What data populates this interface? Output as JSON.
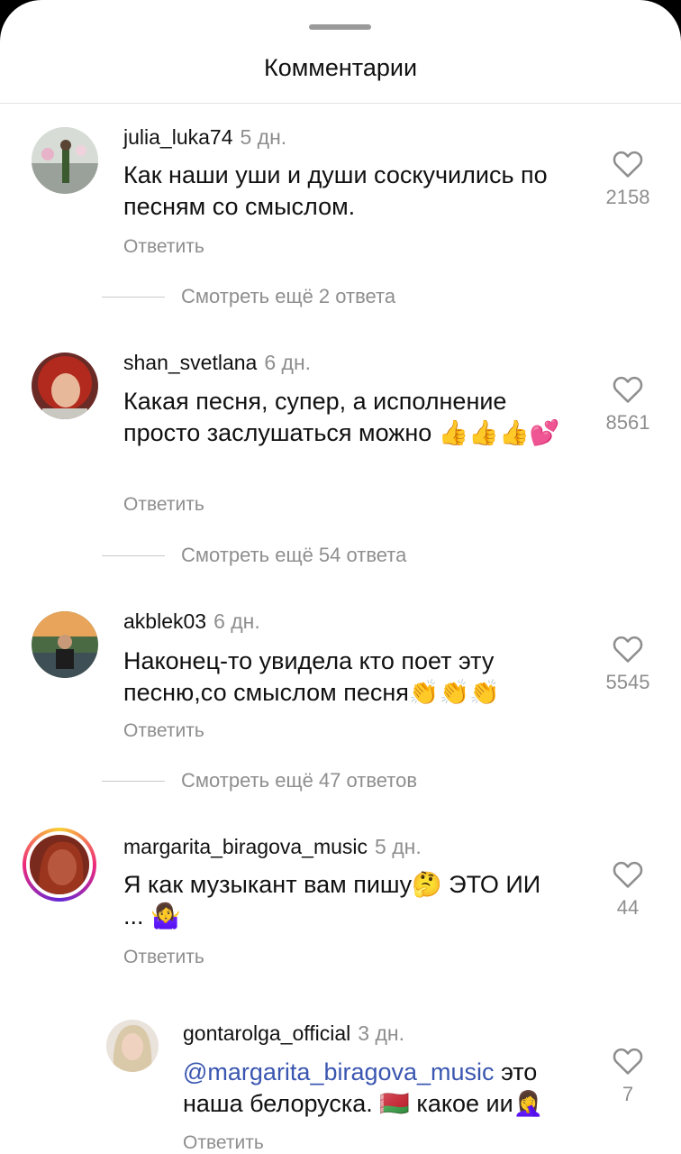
{
  "header": {
    "title": "Комментарии"
  },
  "comments": [
    {
      "username": "julia_luka74",
      "time": "5 дн.",
      "text": "Как наши уши и души соскучились по песням со смыслом.",
      "reply_label": "Ответить",
      "likes": "2158",
      "view_more": "Смотреть ещё 2 ответа"
    },
    {
      "username": "shan_svetlana",
      "time": "6 дн.",
      "text": "Какая песня, супер, а исполнение просто заслушаться можно 👍👍👍💕",
      "reply_label": "Ответить",
      "likes": "8561",
      "view_more": "Смотреть ещё 54 ответа"
    },
    {
      "username": "akblek03",
      "time": "6 дн.",
      "text": "Наконец-то увидела кто поет эту песню,со смыслом песня👏👏👏",
      "reply_label": "Ответить",
      "likes": "5545",
      "view_more": "Смотреть ещё 47 ответов"
    },
    {
      "username": "margarita_biragova_music",
      "time": "5 дн.",
      "text": "Я как музыкант вам пишу🤔 ЭТО ИИ ... 🤷‍♀️",
      "reply_label": "Ответить",
      "likes": "44"
    }
  ],
  "reply": {
    "username": "gontarolga_official",
    "time": "3 дн.",
    "mention": "@margarita_biragova_music",
    "text": " это наша белоруска. 🇧🇾 какое ии🤦‍♀️",
    "reply_label": "Ответить",
    "likes": "7"
  },
  "icons": {
    "like": "heart-outline-icon"
  }
}
